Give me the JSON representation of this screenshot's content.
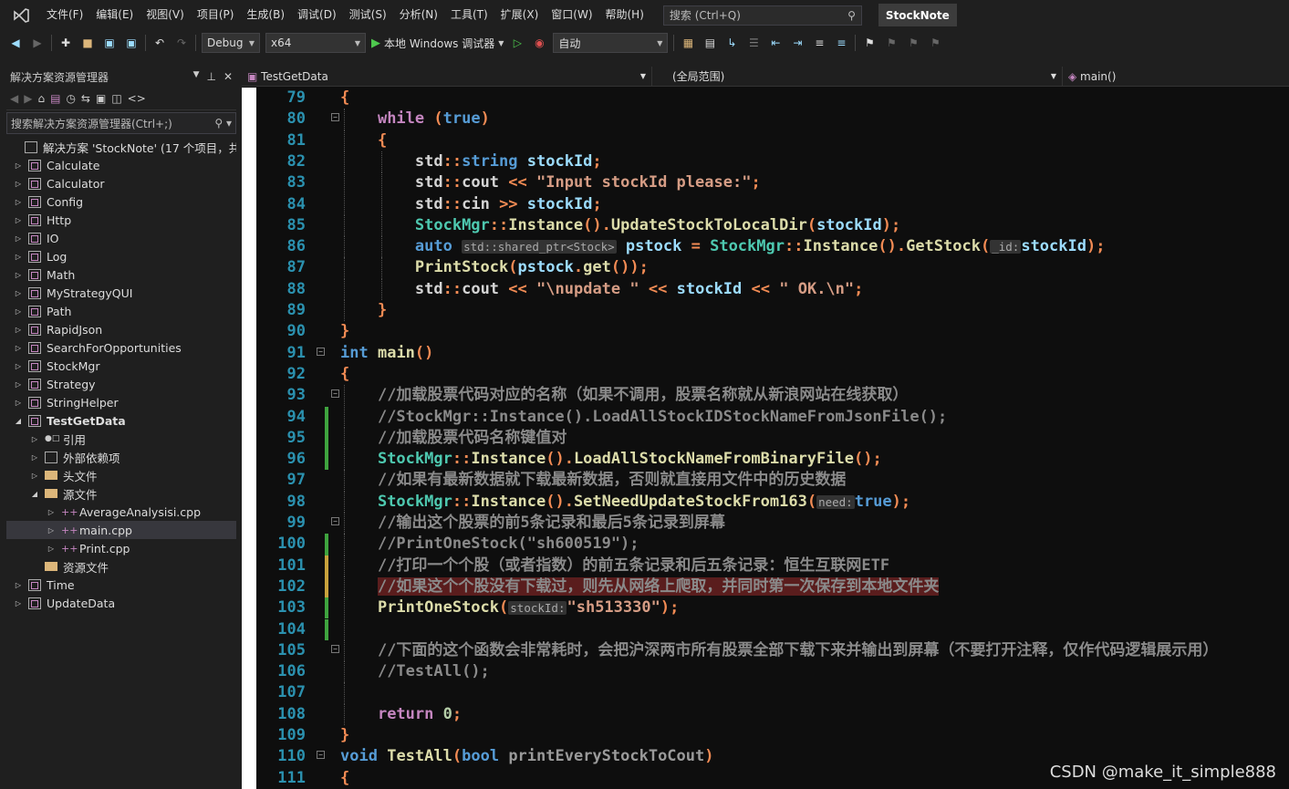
{
  "menu": {
    "items": [
      "文件(F)",
      "编辑(E)",
      "视图(V)",
      "项目(P)",
      "生成(B)",
      "调试(D)",
      "测试(S)",
      "分析(N)",
      "工具(T)",
      "扩展(X)",
      "窗口(W)",
      "帮助(H)"
    ],
    "search_placeholder": "搜索 (Ctrl+Q)",
    "solution_name": "StockNote"
  },
  "toolbar": {
    "config": "Debug",
    "platform": "x64",
    "run_label": "本地 Windows 调试器",
    "mode": "自动"
  },
  "explorer": {
    "title": "解决方案资源管理器",
    "search": "搜索解决方案资源管理器(Ctrl+;)",
    "solution": "解决方案 'StockNote' (17 个项目，共 1",
    "items": [
      "Calculate",
      "Calculator",
      "Config",
      "Http",
      "IO",
      "Log",
      "Math",
      "MyStrategyQUI",
      "Path",
      "RapidJson",
      "SearchForOpportunities",
      "StockMgr",
      "Strategy",
      "StringHelper",
      "TestGetData",
      "引用",
      "外部依赖项",
      "头文件",
      "源文件",
      "AverageAnalysisi.cpp",
      "main.cpp",
      "Print.cpp",
      "资源文件",
      "Time",
      "UpdateData"
    ]
  },
  "editor": {
    "file_tab": "TestGetData",
    "scope": "(全局范围)",
    "function": "main()",
    "line_numbers": [
      "79",
      "80",
      "81",
      "82",
      "83",
      "84",
      "85",
      "86",
      "87",
      "88",
      "89",
      "90",
      "91",
      "92",
      "93",
      "94",
      "95",
      "96",
      "97",
      "98",
      "99",
      "100",
      "101",
      "102",
      "103",
      "104",
      "105",
      "106",
      "107",
      "108",
      "109",
      "110",
      "111"
    ],
    "hints": {
      "id": "_id:",
      "need": "need:",
      "stockId": "stockId:",
      "shared_ptr": "std::shared_ptr<Stock>"
    },
    "comments": {
      "c93": "//加载股票代码对应的名称（如果不调用，股票名称就从新浪网站在线获取）",
      "c94": "//StockMgr::Instance().LoadAllStockIDStockNameFromJsonFile();",
      "c95": "//加载股票代码名称键值对",
      "c97": "//如果有最新数据就下载最新数据，否则就直接用文件中的历史数据",
      "c99": "//输出这个股票的前5条记录和最后5条记录到屏幕",
      "c100": "//PrintOneStock(\"sh600519\");",
      "c101": "//打印一个个股（或者指数）的前五条记录和后五条记录：恒生互联网ETF",
      "c102": "//如果这个个股没有下载过，则先从网络上爬取，并同时第一次保存到本地文件夹",
      "c105": "//下面的这个函数会非常耗时，会把沪深两市所有股票全部下载下来并输出到屏幕（不要打开注释，仅作代码逻辑展示用）",
      "c106": "//TestAll();"
    },
    "strings": {
      "s83": "\"Input stockId please:\"",
      "s88a": "\"\\nupdate \"",
      "s88b": "\" OK.\\n\"",
      "s103": "\"sh513330\""
    }
  },
  "watermark": "CSDN @make_it_simple888"
}
